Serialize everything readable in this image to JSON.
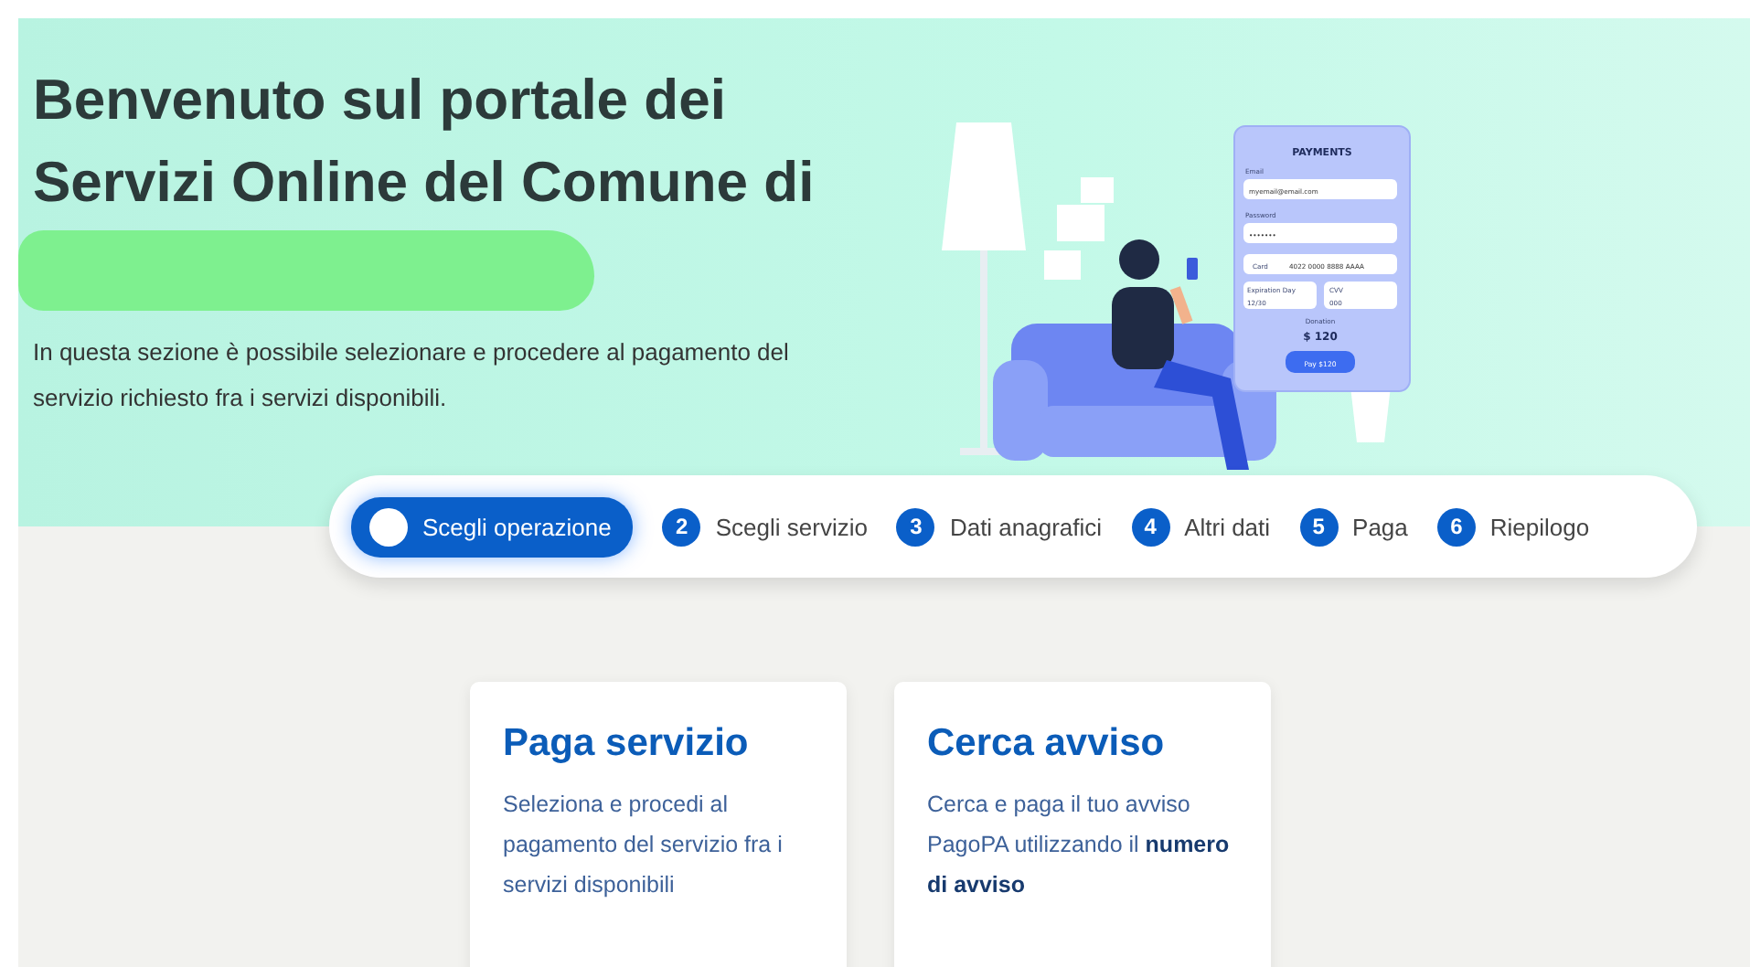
{
  "hero": {
    "title": "Benvenuto sul portale dei Servizi Online del Comune di",
    "description": "In questa sezione è possibile selezionare e procedere al pagamento del servizio richiesto fra i servizi disponibili.",
    "illustration": {
      "phone": {
        "title": "PAYMENTS",
        "email_label": "Email",
        "email_value": "myemail@email.com",
        "password_label": "Password",
        "password_value": "•••••••",
        "card_label": "Card",
        "card_number": "4022 0000 8888 AAAA",
        "expiry_label": "Expiration Day",
        "expiry_value": "12/30",
        "cvv_label": "CVV",
        "cvv_value": "000",
        "amount_label": "Donation",
        "amount": "$ 120",
        "pay_button": "Pay $120"
      }
    }
  },
  "steps": [
    {
      "label": "Scegli operazione",
      "selected": true
    },
    {
      "number": "2",
      "label": "Scegli servizio",
      "selected": false
    },
    {
      "number": "3",
      "label": "Dati anagrafici",
      "selected": false
    },
    {
      "number": "4",
      "label": "Altri dati",
      "selected": false
    },
    {
      "number": "5",
      "label": "Paga",
      "selected": false
    },
    {
      "number": "6",
      "label": "Riepilogo",
      "selected": false
    }
  ],
  "cards": [
    {
      "title": "Paga servizio",
      "text": "Seleziona e procedi al pagamento del servizio fra i servizi disponibili"
    },
    {
      "title": "Cerca avviso",
      "text": "Cerca e paga il tuo avviso PagoPA utilizzando il **numero di avviso**"
    }
  ]
}
